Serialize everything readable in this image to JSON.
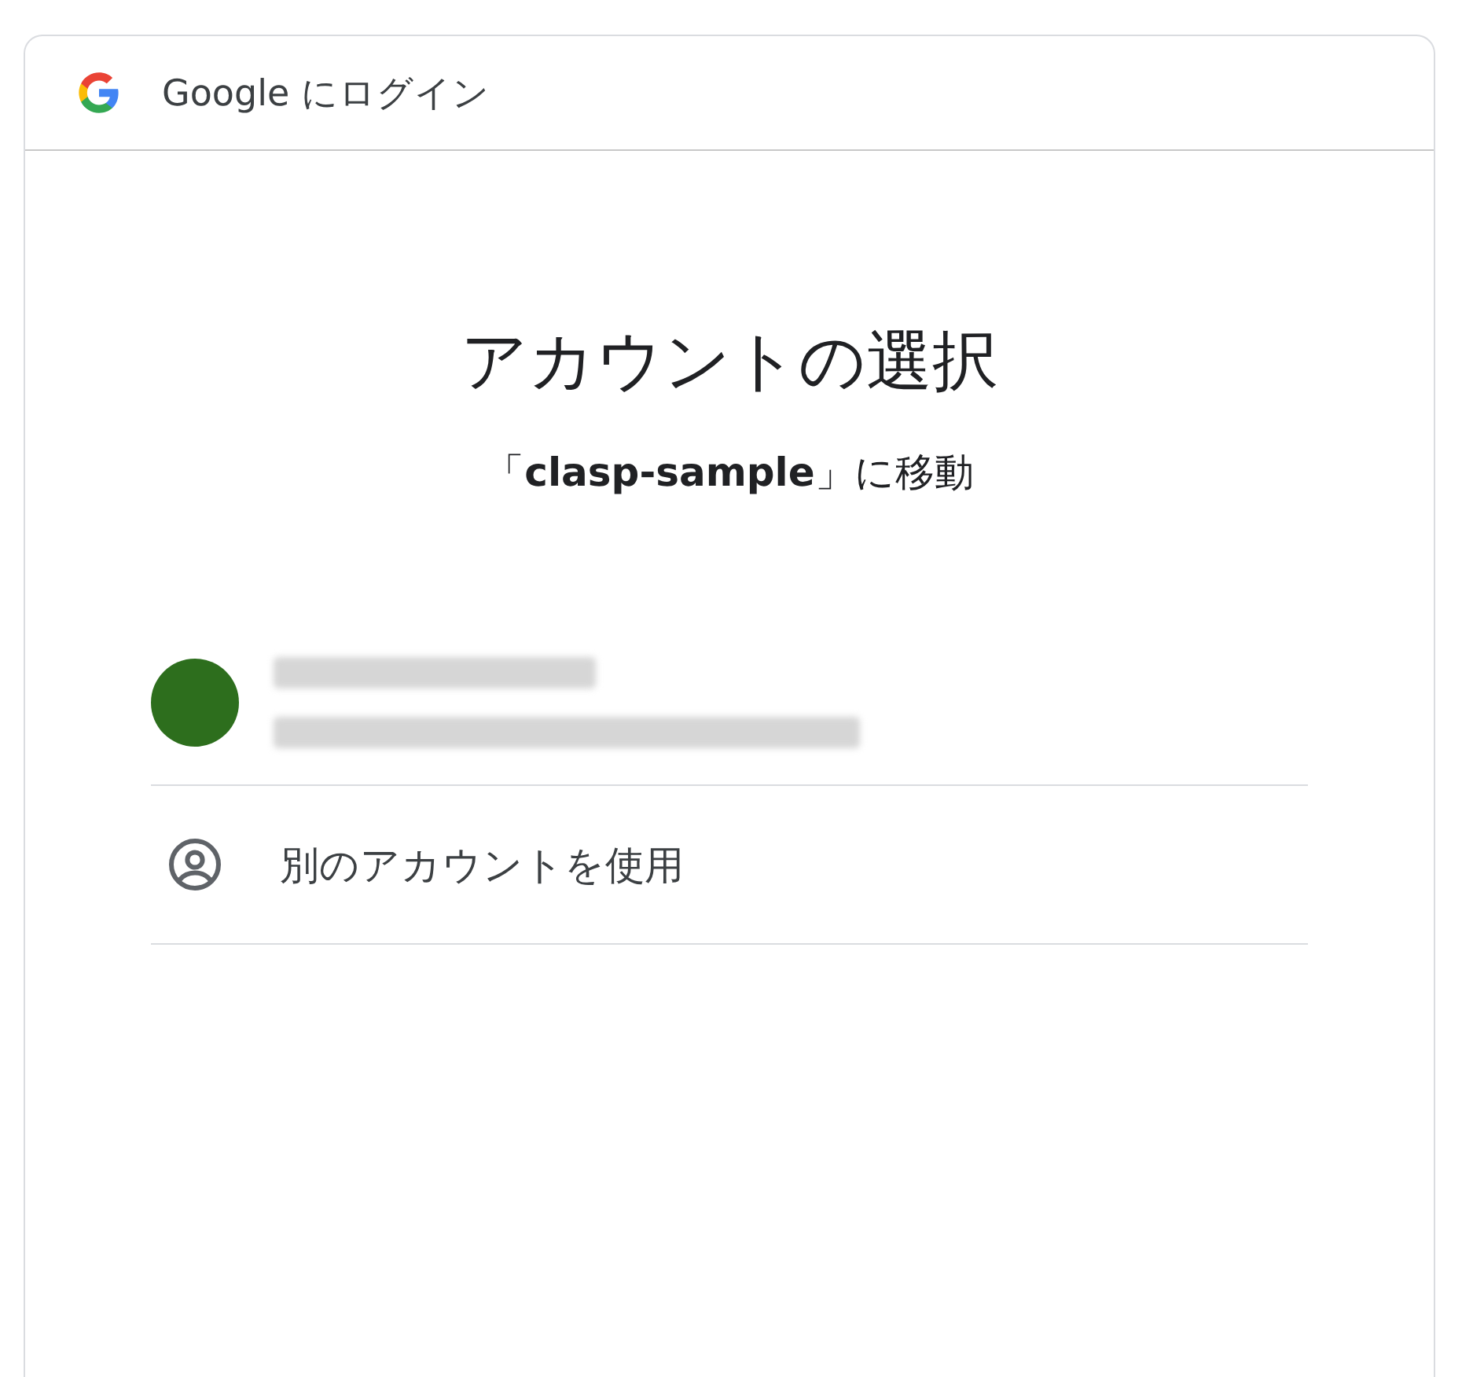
{
  "header": {
    "title": "Google にログイン"
  },
  "heading": "アカウントの選択",
  "subtitle": "「**clasp-sample**」に移動",
  "accounts": [
    {
      "kind": "redacted"
    }
  ],
  "other_account": {
    "label": "別のアカウントを使用"
  }
}
